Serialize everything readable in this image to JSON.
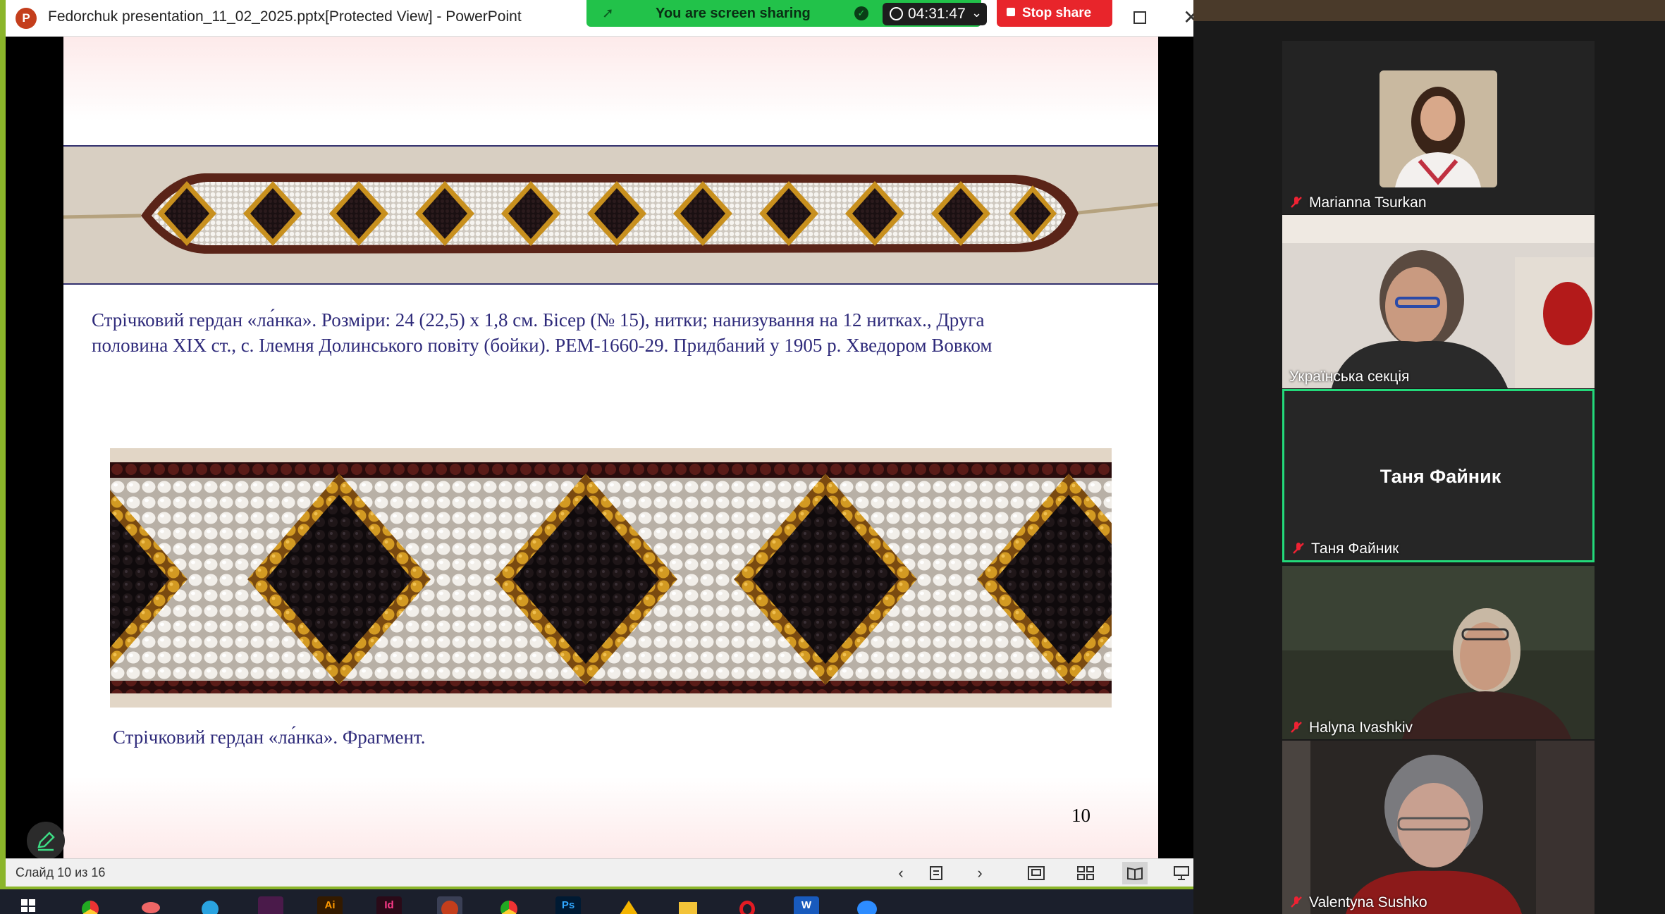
{
  "powerpoint": {
    "logo_letter": "P",
    "title": "Fedorchuk presentation_11_02_2025.pptx[Protected View] - PowerPoint",
    "close_glyph": "✕"
  },
  "share_bar": {
    "sharing_text": "You are screen sharing",
    "timer": "04:31:47",
    "stop_label": "Stop share",
    "accent_color": "#22c24a",
    "stop_color": "#e8252b"
  },
  "slide": {
    "caption_main": "Стрічковий гердан «ла́нка». Розміри: 24 (22,5) х 1,8 см. Бісер (№ 15), нитки; нанизування на 12 нитках., Друга половина ХІХ ст., с. Ілемня Долинського повіту (бойки). РЕМ-1660-29. Придбаний у 1905 р. Хведором Вовком",
    "caption_fragment": "Стрічковий гердан «ла́нка». Фрагмент.",
    "page_number": "10",
    "text_color": "#2e2a7a"
  },
  "statusbar": {
    "slide_counter": "Слайд 10 из 16"
  },
  "taskbar": {
    "apps": [
      "windows-start",
      "chrome",
      "eye-app",
      "telegram",
      "figma-like",
      "illustrator",
      "indesign",
      "powerpoint",
      "chrome-2",
      "photoshop",
      "google-drive",
      "file-explorer",
      "opera",
      "word",
      "zoom"
    ]
  },
  "gallery": {
    "participants": [
      {
        "name": "Marianna Tsurkan",
        "muted": true
      },
      {
        "name": "Українська секція",
        "muted": false
      },
      {
        "name": "Таня Файник",
        "muted": true,
        "active_speaker_frame": true,
        "video_off": true
      },
      {
        "name": "Halyna Ivashkiv",
        "muted": true
      },
      {
        "name": "Valentyna Sushko",
        "muted": true
      }
    ],
    "active_color": "#23d97a"
  }
}
